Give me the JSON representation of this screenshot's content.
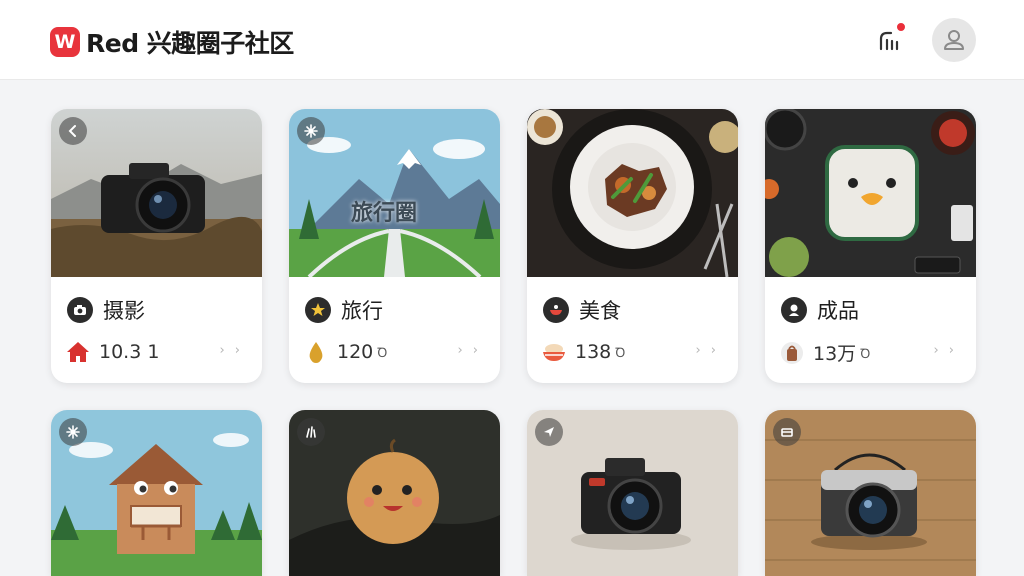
{
  "app": {
    "logo_letter": "W",
    "title": "Red 兴趣圈子社区"
  },
  "header": {
    "notification_icon": "signal-bars-icon",
    "avatar_icon": "user-icon",
    "notification_dot_color": "#ea2f3a"
  },
  "colors": {
    "brand": "#e8343c"
  },
  "cards": [
    {
      "name": "摄影",
      "count": "10.3 1",
      "unit": "",
      "chevron": "› ›",
      "overlay_icon": "back-icon",
      "category_icon": "camera-icon",
      "stat_icon": "house-icon"
    },
    {
      "name": "旅行",
      "count": "120",
      "unit": "Ꝺ",
      "chevron": "› ›",
      "overlay_icon": "sparkle-icon",
      "category_icon": "star-badge-icon",
      "stat_icon": "drop-icon",
      "image_text": "旅行圈"
    },
    {
      "name": "美食",
      "count": "138",
      "unit": "Ꝺ",
      "chevron": "› ›",
      "overlay_icon": "",
      "category_icon": "bowl-icon",
      "stat_icon": "food-bowl-icon"
    },
    {
      "name": "成品",
      "count": "13万",
      "unit": "Ꝺ",
      "chevron": "› ›",
      "overlay_icon": "",
      "category_icon": "badge-icon",
      "stat_icon": "bag-icon"
    }
  ],
  "cards_row2": [
    {
      "overlay_icon": "sparkle-icon"
    },
    {
      "overlay_icon": "grass-icon"
    },
    {
      "overlay_icon": "send-icon"
    },
    {
      "overlay_icon": "card-icon"
    }
  ]
}
